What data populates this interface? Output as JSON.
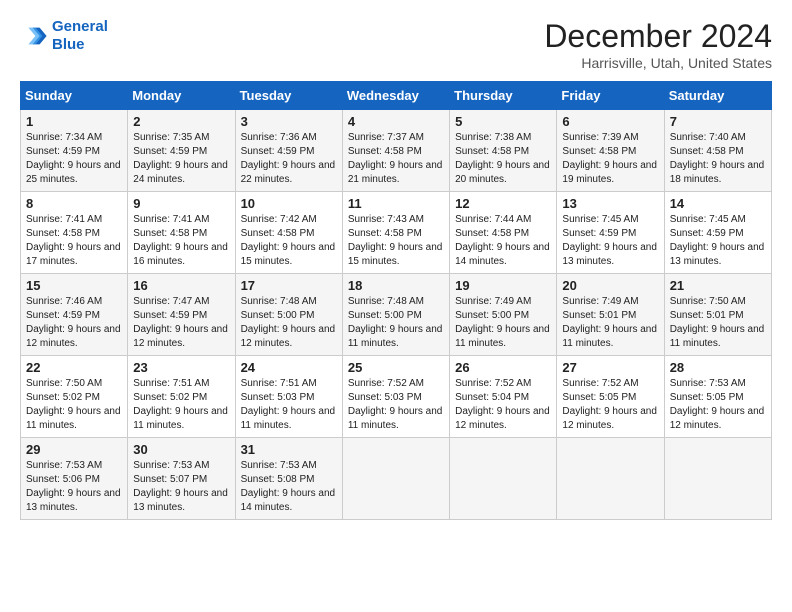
{
  "logo": {
    "line1": "General",
    "line2": "Blue"
  },
  "title": "December 2024",
  "location": "Harrisville, Utah, United States",
  "days_of_week": [
    "Sunday",
    "Monday",
    "Tuesday",
    "Wednesday",
    "Thursday",
    "Friday",
    "Saturday"
  ],
  "weeks": [
    [
      {
        "day": "1",
        "sunrise": "7:34 AM",
        "sunset": "4:59 PM",
        "daylight": "9 hours and 25 minutes."
      },
      {
        "day": "2",
        "sunrise": "7:35 AM",
        "sunset": "4:59 PM",
        "daylight": "9 hours and 24 minutes."
      },
      {
        "day": "3",
        "sunrise": "7:36 AM",
        "sunset": "4:59 PM",
        "daylight": "9 hours and 22 minutes."
      },
      {
        "day": "4",
        "sunrise": "7:37 AM",
        "sunset": "4:58 PM",
        "daylight": "9 hours and 21 minutes."
      },
      {
        "day": "5",
        "sunrise": "7:38 AM",
        "sunset": "4:58 PM",
        "daylight": "9 hours and 20 minutes."
      },
      {
        "day": "6",
        "sunrise": "7:39 AM",
        "sunset": "4:58 PM",
        "daylight": "9 hours and 19 minutes."
      },
      {
        "day": "7",
        "sunrise": "7:40 AM",
        "sunset": "4:58 PM",
        "daylight": "9 hours and 18 minutes."
      }
    ],
    [
      {
        "day": "8",
        "sunrise": "7:41 AM",
        "sunset": "4:58 PM",
        "daylight": "9 hours and 17 minutes."
      },
      {
        "day": "9",
        "sunrise": "7:41 AM",
        "sunset": "4:58 PM",
        "daylight": "9 hours and 16 minutes."
      },
      {
        "day": "10",
        "sunrise": "7:42 AM",
        "sunset": "4:58 PM",
        "daylight": "9 hours and 15 minutes."
      },
      {
        "day": "11",
        "sunrise": "7:43 AM",
        "sunset": "4:58 PM",
        "daylight": "9 hours and 15 minutes."
      },
      {
        "day": "12",
        "sunrise": "7:44 AM",
        "sunset": "4:58 PM",
        "daylight": "9 hours and 14 minutes."
      },
      {
        "day": "13",
        "sunrise": "7:45 AM",
        "sunset": "4:59 PM",
        "daylight": "9 hours and 13 minutes."
      },
      {
        "day": "14",
        "sunrise": "7:45 AM",
        "sunset": "4:59 PM",
        "daylight": "9 hours and 13 minutes."
      }
    ],
    [
      {
        "day": "15",
        "sunrise": "7:46 AM",
        "sunset": "4:59 PM",
        "daylight": "9 hours and 12 minutes."
      },
      {
        "day": "16",
        "sunrise": "7:47 AM",
        "sunset": "4:59 PM",
        "daylight": "9 hours and 12 minutes."
      },
      {
        "day": "17",
        "sunrise": "7:48 AM",
        "sunset": "5:00 PM",
        "daylight": "9 hours and 12 minutes."
      },
      {
        "day": "18",
        "sunrise": "7:48 AM",
        "sunset": "5:00 PM",
        "daylight": "9 hours and 11 minutes."
      },
      {
        "day": "19",
        "sunrise": "7:49 AM",
        "sunset": "5:00 PM",
        "daylight": "9 hours and 11 minutes."
      },
      {
        "day": "20",
        "sunrise": "7:49 AM",
        "sunset": "5:01 PM",
        "daylight": "9 hours and 11 minutes."
      },
      {
        "day": "21",
        "sunrise": "7:50 AM",
        "sunset": "5:01 PM",
        "daylight": "9 hours and 11 minutes."
      }
    ],
    [
      {
        "day": "22",
        "sunrise": "7:50 AM",
        "sunset": "5:02 PM",
        "daylight": "9 hours and 11 minutes."
      },
      {
        "day": "23",
        "sunrise": "7:51 AM",
        "sunset": "5:02 PM",
        "daylight": "9 hours and 11 minutes."
      },
      {
        "day": "24",
        "sunrise": "7:51 AM",
        "sunset": "5:03 PM",
        "daylight": "9 hours and 11 minutes."
      },
      {
        "day": "25",
        "sunrise": "7:52 AM",
        "sunset": "5:03 PM",
        "daylight": "9 hours and 11 minutes."
      },
      {
        "day": "26",
        "sunrise": "7:52 AM",
        "sunset": "5:04 PM",
        "daylight": "9 hours and 12 minutes."
      },
      {
        "day": "27",
        "sunrise": "7:52 AM",
        "sunset": "5:05 PM",
        "daylight": "9 hours and 12 minutes."
      },
      {
        "day": "28",
        "sunrise": "7:53 AM",
        "sunset": "5:05 PM",
        "daylight": "9 hours and 12 minutes."
      }
    ],
    [
      {
        "day": "29",
        "sunrise": "7:53 AM",
        "sunset": "5:06 PM",
        "daylight": "9 hours and 13 minutes."
      },
      {
        "day": "30",
        "sunrise": "7:53 AM",
        "sunset": "5:07 PM",
        "daylight": "9 hours and 13 minutes."
      },
      {
        "day": "31",
        "sunrise": "7:53 AM",
        "sunset": "5:08 PM",
        "daylight": "9 hours and 14 minutes."
      },
      null,
      null,
      null,
      null
    ]
  ]
}
